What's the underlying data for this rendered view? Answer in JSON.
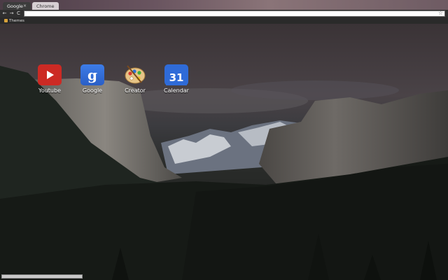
{
  "tabs": [
    {
      "label": "Google",
      "active": true,
      "close": "×"
    },
    {
      "label": "Chrome",
      "active": false
    }
  ],
  "toolbar": {
    "back_icon": "←",
    "forward_icon": "→",
    "reload_icon": "C",
    "omnibox_value": "",
    "star_icon": "☆"
  },
  "bookmarks": [
    {
      "label": "Themes"
    }
  ],
  "apps": [
    {
      "label": "Youtube",
      "icon": "youtube-icon"
    },
    {
      "label": "Google",
      "icon": "google-icon",
      "glyph": "g"
    },
    {
      "label": "Creator",
      "icon": "palette-icon"
    },
    {
      "label": "Calendar",
      "icon": "calendar-icon",
      "day": "31"
    }
  ],
  "colors": {
    "titlebar": "#6a5560",
    "youtube": "#cc2a24",
    "google_blue": "#3d7de8",
    "calendar_blue": "#2f6bd8"
  }
}
